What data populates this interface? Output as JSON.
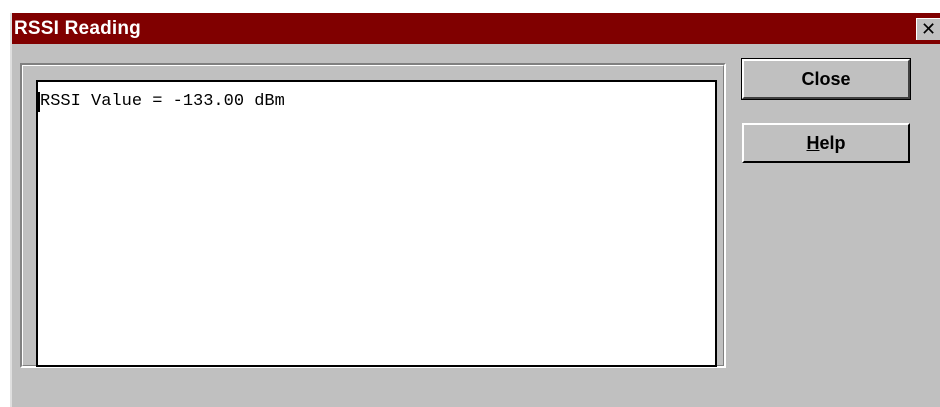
{
  "window": {
    "title": "RSSI Reading",
    "close_glyph": "✕"
  },
  "output": {
    "text": "RSSI Value = -133.00 dBm"
  },
  "buttons": {
    "close_label": "Close",
    "help_mnemonic": "H",
    "help_rest": "elp"
  },
  "colors": {
    "titlebar": "#800000",
    "face": "#c0c0c0"
  }
}
